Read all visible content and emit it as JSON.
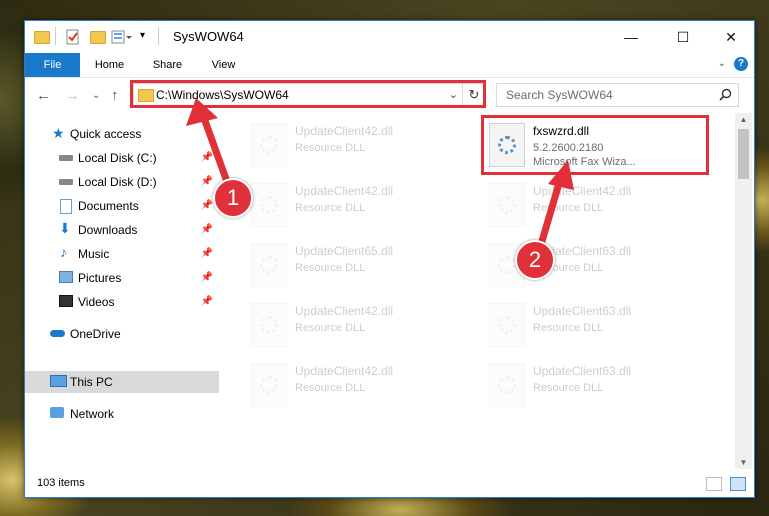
{
  "window": {
    "title": "SysWOW64",
    "controls": {
      "minimize": "—",
      "maximize": "☐",
      "close": "✕"
    }
  },
  "ribbon": {
    "tabs": [
      {
        "label": "File"
      },
      {
        "label": "Home"
      },
      {
        "label": "Share"
      },
      {
        "label": "View"
      }
    ],
    "help": "?"
  },
  "address": {
    "path": "C:\\Windows\\SysWOW64",
    "search_placeholder": "Search SysWOW64"
  },
  "sidebar": {
    "items": [
      {
        "label": "Quick access",
        "icon": "star-icon",
        "pinned": false
      },
      {
        "label": "Local Disk (C:)",
        "icon": "drive-icon",
        "pinned": true
      },
      {
        "label": "Local Disk (D:)",
        "icon": "drive-icon",
        "pinned": true
      },
      {
        "label": "Documents",
        "icon": "documents-icon",
        "pinned": true
      },
      {
        "label": "Downloads",
        "icon": "download-icon",
        "pinned": true
      },
      {
        "label": "Music",
        "icon": "music-icon",
        "pinned": true
      },
      {
        "label": "Pictures",
        "icon": "pictures-icon",
        "pinned": true
      },
      {
        "label": "Videos",
        "icon": "videos-icon",
        "pinned": true
      },
      {
        "label": "OneDrive",
        "icon": "cloud-icon",
        "pinned": false
      },
      {
        "label": "This PC",
        "icon": "computer-icon",
        "pinned": false,
        "selected": true
      },
      {
        "label": "Network",
        "icon": "network-icon",
        "pinned": false
      }
    ]
  },
  "files": {
    "left_column": [
      {
        "name": "UpdateClient42.dll",
        "type": "Resource DLL"
      },
      {
        "name": "UpdateClient42.dll",
        "type": "Resource DLL"
      },
      {
        "name": "UpdateClient65.dll",
        "type": "Resource DLL"
      },
      {
        "name": "UpdateClient42.dll",
        "type": "Resource DLL"
      },
      {
        "name": "UpdateClient42.dll",
        "type": "Resource DLL"
      }
    ],
    "right_column": [
      {
        "name": "fxswzrd.dll",
        "version": "5.2.2600.2180",
        "description": "Microsoft  Fax Wiza..."
      },
      {
        "name": "UpdateClient42.dll",
        "type": "Resource DLL"
      },
      {
        "name": "UpdateClient63.dll",
        "type": "Resource DLL"
      },
      {
        "name": "UpdateClient63.dll",
        "type": "Resource DLL"
      },
      {
        "name": "UpdateClient63.dll",
        "type": "Resource DLL"
      }
    ]
  },
  "status": {
    "items_count": "103 items"
  },
  "callouts": {
    "one": "1",
    "two": "2"
  },
  "colors": {
    "accent": "#1979ca",
    "highlight": "#e0303a"
  }
}
